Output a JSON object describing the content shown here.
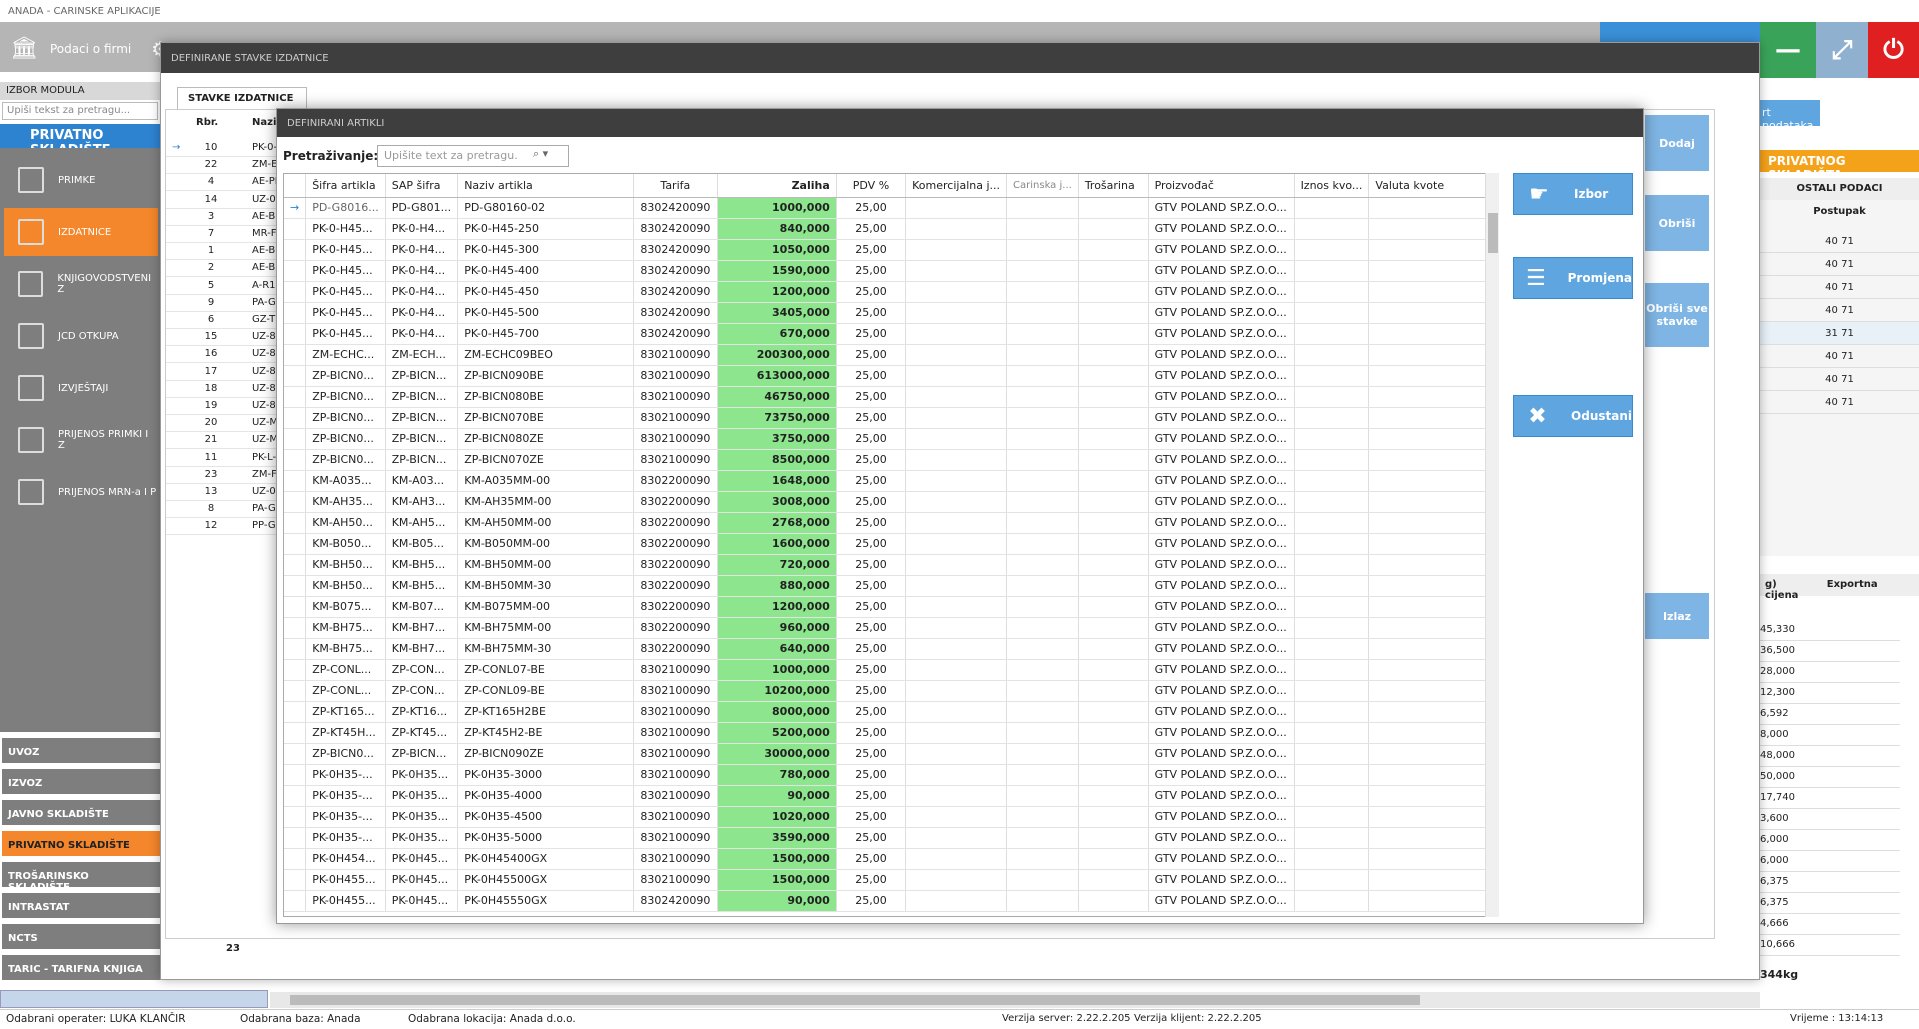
{
  "app": {
    "title": "ANADA - CARINSKE APLIKACIJE",
    "home_label": "Podaci o firmi",
    "right_link": "rt podataka"
  },
  "sidebar": {
    "label": "IZBOR MODULA",
    "search_placeholder": "Upiši tekst za pretragu...",
    "header": "PRIVATNO SKLADIŠTE",
    "items": [
      {
        "label": "PRIMKE"
      },
      {
        "label": "IZDATNICE"
      },
      {
        "label": "KNJIGOVODSTVENI Z"
      },
      {
        "label": "JCD OTKUPA"
      },
      {
        "label": "IZVJEŠTAJI"
      },
      {
        "label": "PRIJENOS PRIMKI I Z"
      },
      {
        "label": "PRIJENOS MRN-a I P"
      }
    ],
    "modules": [
      "UVOZ",
      "IZVOZ",
      "JAVNO SKLADIŠTE",
      "PRIVATNO SKLADIŠTE",
      "TROŠARINSKO SKLADIŠTE",
      "INTRASTAT",
      "NCTS",
      "TARIC - TARIFNA KNJIGA"
    ]
  },
  "right_panel": {
    "header": "PRIVATNOG SKLADIŠTA",
    "tab": "OSTALI PODACI",
    "col": "Postupak",
    "values": [
      "40 71",
      "40 71",
      "40 71",
      "40 71",
      "31 71",
      "40 71",
      "40 71",
      "40 71"
    ],
    "col2a": "g)",
    "col2b": "Exportna cijena",
    "values2": [
      "45,330",
      "36,500",
      "28,000",
      "12,300",
      "6,592",
      "8,000",
      "48,000",
      "50,000",
      "17,740",
      "3,600",
      "6,000",
      "6,000",
      "6,375",
      "6,375",
      "4,666",
      "10,666"
    ],
    "footer": "344kg"
  },
  "outer_dialog": {
    "title": "DEFINIRANE STAVKE IZDATNICE",
    "tab": "STAVKE IZDATNICE",
    "col_rbr": "Rbr.",
    "col_naz": "Naziv",
    "rows": [
      {
        "rbr": "10",
        "naz": "PK-0-"
      },
      {
        "rbr": "22",
        "naz": "ZM-E"
      },
      {
        "rbr": "4",
        "naz": "AE-PI"
      },
      {
        "rbr": "14",
        "naz": "UZ-0"
      },
      {
        "rbr": "3",
        "naz": "AE-BI"
      },
      {
        "rbr": "7",
        "naz": "MR-F"
      },
      {
        "rbr": "1",
        "naz": "AE-BI"
      },
      {
        "rbr": "2",
        "naz": "AE-BI"
      },
      {
        "rbr": "5",
        "naz": "A-R1-"
      },
      {
        "rbr": "9",
        "naz": "PA-G"
      },
      {
        "rbr": "6",
        "naz": "GZ-T"
      },
      {
        "rbr": "15",
        "naz": "UZ-8"
      },
      {
        "rbr": "16",
        "naz": "UZ-8"
      },
      {
        "rbr": "17",
        "naz": "UZ-8"
      },
      {
        "rbr": "18",
        "naz": "UZ-8"
      },
      {
        "rbr": "19",
        "naz": "UZ-8"
      },
      {
        "rbr": "20",
        "naz": "UZ-M"
      },
      {
        "rbr": "21",
        "naz": "UZ-M"
      },
      {
        "rbr": "11",
        "naz": "PK-L-"
      },
      {
        "rbr": "23",
        "naz": "ZM-F"
      },
      {
        "rbr": "13",
        "naz": "UZ-0"
      },
      {
        "rbr": "8",
        "naz": "PA-G"
      },
      {
        "rbr": "12",
        "naz": "PP-G"
      }
    ],
    "count": "23",
    "buttons": {
      "dodaj": "Dodaj",
      "obrisi": "Obriši",
      "obrisi_sve": "Obriši sve stavke",
      "izlaz": "Izlaz"
    }
  },
  "inner_dialog": {
    "title": "DEFINIRANI ARTIKLI",
    "search_label": "Pretraživanje:",
    "search_placeholder": "Upišite text za pretragu.",
    "columns": [
      "Šifra artikla",
      "SAP šifra",
      "Naziv artikla",
      "Tarifa",
      "Zaliha",
      "PDV %",
      "Komercijalna j...",
      "Carinska j...",
      "Trošarina",
      "Proizvođač",
      "Iznos kvo...",
      "Valuta kvote"
    ],
    "rows": [
      [
        "PD-G8016...",
        "PD-G801...",
        "PD-G80160-02",
        "8302420090",
        "1000,000",
        "25,00",
        "GTV POLAND SP.Z.O.O..."
      ],
      [
        "PK-0-H45...",
        "PK-0-H4...",
        "PK-0-H45-250",
        "8302420090",
        "840,000",
        "25,00",
        "GTV POLAND SP.Z.O.O..."
      ],
      [
        "PK-0-H45...",
        "PK-0-H4...",
        "PK-0-H45-300",
        "8302420090",
        "1050,000",
        "25,00",
        "GTV POLAND SP.Z.O.O..."
      ],
      [
        "PK-0-H45...",
        "PK-0-H4...",
        "PK-0-H45-400",
        "8302420090",
        "1590,000",
        "25,00",
        "GTV POLAND SP.Z.O.O..."
      ],
      [
        "PK-0-H45...",
        "PK-0-H4...",
        "PK-0-H45-450",
        "8302420090",
        "1200,000",
        "25,00",
        "GTV POLAND SP.Z.O.O..."
      ],
      [
        "PK-0-H45...",
        "PK-0-H4...",
        "PK-0-H45-500",
        "8302420090",
        "3405,000",
        "25,00",
        "GTV POLAND SP.Z.O.O..."
      ],
      [
        "PK-0-H45...",
        "PK-0-H4...",
        "PK-0-H45-700",
        "8302420090",
        "670,000",
        "25,00",
        "GTV POLAND SP.Z.O.O..."
      ],
      [
        "ZM-ECHC...",
        "ZM-ECH...",
        "ZM-ECHC09BEO",
        "8302100090",
        "200300,000",
        "25,00",
        "GTV POLAND SP.Z.O.O..."
      ],
      [
        "ZP-BICN0...",
        "ZP-BICN...",
        "ZP-BICN090BE",
        "8302100090",
        "613000,000",
        "25,00",
        "GTV POLAND SP.Z.O.O..."
      ],
      [
        "ZP-BICN0...",
        "ZP-BICN...",
        "ZP-BICN080BE",
        "8302100090",
        "46750,000",
        "25,00",
        "GTV POLAND SP.Z.O.O..."
      ],
      [
        "ZP-BICN0...",
        "ZP-BICN...",
        "ZP-BICN070BE",
        "8302100090",
        "73750,000",
        "25,00",
        "GTV POLAND SP.Z.O.O..."
      ],
      [
        "ZP-BICN0...",
        "ZP-BICN...",
        "ZP-BICN080ZE",
        "8302100090",
        "3750,000",
        "25,00",
        "GTV POLAND SP.Z.O.O..."
      ],
      [
        "ZP-BICN0...",
        "ZP-BICN...",
        "ZP-BICN070ZE",
        "8302100090",
        "8500,000",
        "25,00",
        "GTV POLAND SP.Z.O.O..."
      ],
      [
        "KM-A035...",
        "KM-A03...",
        "KM-A035MM-00",
        "8302200090",
        "1648,000",
        "25,00",
        "GTV POLAND SP.Z.O.O..."
      ],
      [
        "KM-AH35...",
        "KM-AH3...",
        "KM-AH35MM-00",
        "8302200090",
        "3008,000",
        "25,00",
        "GTV POLAND SP.Z.O.O..."
      ],
      [
        "KM-AH50...",
        "KM-AH5...",
        "KM-AH50MM-00",
        "8302200090",
        "2768,000",
        "25,00",
        "GTV POLAND SP.Z.O.O..."
      ],
      [
        "KM-B050...",
        "KM-B05...",
        "KM-B050MM-00",
        "8302200090",
        "1600,000",
        "25,00",
        "GTV POLAND SP.Z.O.O..."
      ],
      [
        "KM-BH50...",
        "KM-BH5...",
        "KM-BH50MM-00",
        "8302200090",
        "720,000",
        "25,00",
        "GTV POLAND SP.Z.O.O..."
      ],
      [
        "KM-BH50...",
        "KM-BH5...",
        "KM-BH50MM-30",
        "8302200090",
        "880,000",
        "25,00",
        "GTV POLAND SP.Z.O.O..."
      ],
      [
        "KM-B075...",
        "KM-B07...",
        "KM-B075MM-00",
        "8302200090",
        "1200,000",
        "25,00",
        "GTV POLAND SP.Z.O.O..."
      ],
      [
        "KM-BH75...",
        "KM-BH7...",
        "KM-BH75MM-00",
        "8302200090",
        "960,000",
        "25,00",
        "GTV POLAND SP.Z.O.O..."
      ],
      [
        "KM-BH75...",
        "KM-BH7...",
        "KM-BH75MM-30",
        "8302200090",
        "640,000",
        "25,00",
        "GTV POLAND SP.Z.O.O..."
      ],
      [
        "ZP-CONL...",
        "ZP-CON...",
        "ZP-CONL07-BE",
        "8302100090",
        "1000,000",
        "25,00",
        "GTV POLAND SP.Z.O.O..."
      ],
      [
        "ZP-CONL...",
        "ZP-CON...",
        "ZP-CONL09-BE",
        "8302100090",
        "10200,000",
        "25,00",
        "GTV POLAND SP.Z.O.O..."
      ],
      [
        "ZP-KT165...",
        "ZP-KT16...",
        "ZP-KT165H2BE",
        "8302100090",
        "8000,000",
        "25,00",
        "GTV POLAND SP.Z.O.O..."
      ],
      [
        "ZP-KT45H...",
        "ZP-KT45...",
        "ZP-KT45H2-BE",
        "8302100090",
        "5200,000",
        "25,00",
        "GTV POLAND SP.Z.O.O..."
      ],
      [
        "ZP-BICN0...",
        "ZP-BICN...",
        "ZP-BICN090ZE",
        "8302100090",
        "30000,000",
        "25,00",
        "GTV POLAND SP.Z.O.O..."
      ],
      [
        "PK-0H35-...",
        "PK-0H35...",
        "PK-0H35-3000",
        "8302100090",
        "780,000",
        "25,00",
        "GTV POLAND SP.Z.O.O..."
      ],
      [
        "PK-0H35-...",
        "PK-0H35...",
        "PK-0H35-4000",
        "8302100090",
        "90,000",
        "25,00",
        "GTV POLAND SP.Z.O.O..."
      ],
      [
        "PK-0H35-...",
        "PK-0H35...",
        "PK-0H35-4500",
        "8302100090",
        "1020,000",
        "25,00",
        "GTV POLAND SP.Z.O.O..."
      ],
      [
        "PK-0H35-...",
        "PK-0H35...",
        "PK-0H35-5000",
        "8302100090",
        "3590,000",
        "25,00",
        "GTV POLAND SP.Z.O.O..."
      ],
      [
        "PK-0H454...",
        "PK-0H45...",
        "PK-0H45400GX",
        "8302100090",
        "1500,000",
        "25,00",
        "GTV POLAND SP.Z.O.O..."
      ],
      [
        "PK-0H455...",
        "PK-0H45...",
        "PK-0H45500GX",
        "8302100090",
        "1500,000",
        "25,00",
        "GTV POLAND SP.Z.O.O..."
      ],
      [
        "PK-0H455...",
        "PK-0H45...",
        "PK-0H45550GX",
        "8302420090",
        "90,000",
        "25,00",
        "GTV POLAND SP.Z.O.O..."
      ]
    ],
    "buttons": {
      "izbor": "Izbor",
      "promjena": "Promjena",
      "odustani": "Odustani"
    }
  },
  "status": {
    "operater": "Odabrani operater: LUKA KLANČIR",
    "baza": "Odabrana baza: Anada",
    "lokacija": "Odabrana lokacija: Anada d.o.o.",
    "verzija_server": "Verzija server: 2.22.2.205",
    "verzija_klijent": "Verzija klijent: 2.22.2.205",
    "vrijeme": "Vrijeme : 13:14:13"
  }
}
